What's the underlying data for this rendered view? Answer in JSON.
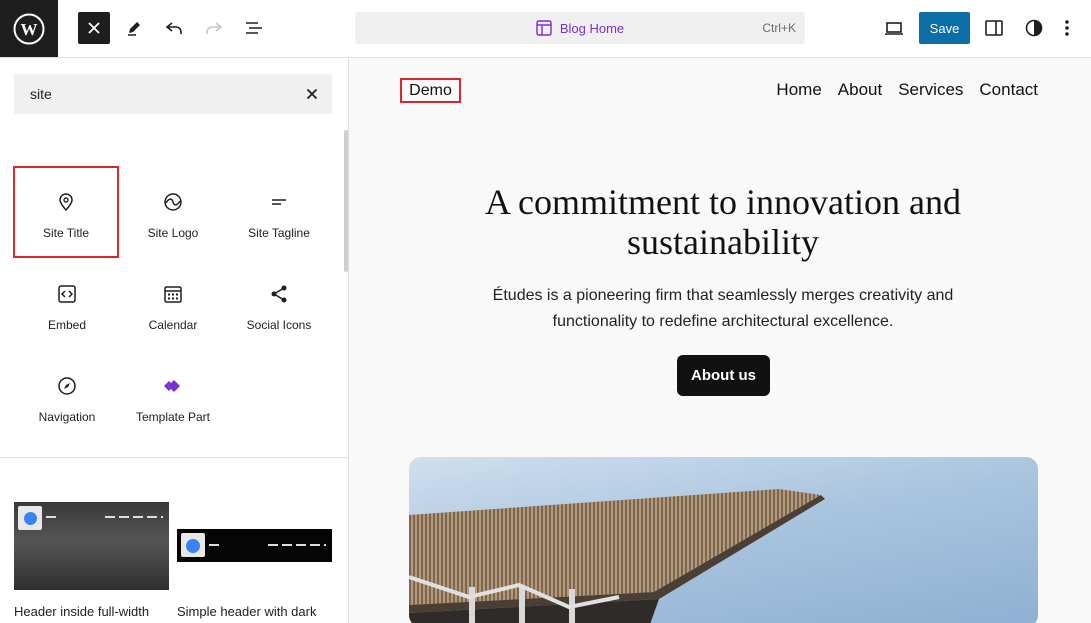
{
  "toolbar": {
    "logo_icon": "wordpress-icon",
    "close_icon": "close-icon",
    "pen_icon": "pencil-icon",
    "undo_icon": "undo-icon",
    "redo_icon": "redo-icon",
    "outline_icon": "list-view-icon",
    "template_label": "Blog Home",
    "template_icon": "layout-icon",
    "shortcut": "Ctrl+K",
    "view_icon": "desktop-icon",
    "save_label": "Save",
    "settings_icon": "sidebar-icon",
    "styles_icon": "contrast-icon",
    "more_icon": "more-vertical-icon",
    "accent_color": "#0b6ea6",
    "template_color": "#7b2fd0"
  },
  "sidebar": {
    "search": {
      "value": "site",
      "placeholder": ""
    },
    "blocks": [
      {
        "label": "Site Title",
        "icon": "map-pin-icon",
        "highlighted": true
      },
      {
        "label": "Site Logo",
        "icon": "site-logo-icon"
      },
      {
        "label": "Site Tagline",
        "icon": "tagline-icon"
      },
      {
        "label": "Embed",
        "icon": "embed-icon"
      },
      {
        "label": "Calendar",
        "icon": "calendar-icon"
      },
      {
        "label": "Social Icons",
        "icon": "share-icon"
      },
      {
        "label": "Navigation",
        "icon": "compass-icon"
      },
      {
        "label": "Template Part",
        "icon": "template-part-icon"
      }
    ],
    "patterns": [
      {
        "label": "Header inside full-width"
      },
      {
        "label": "Simple header with dark"
      }
    ]
  },
  "canvas": {
    "site_title": "Demo",
    "nav": [
      "Home",
      "About",
      "Services",
      "Contact"
    ],
    "hero_title": "A commitment to innovation and sustainability",
    "hero_text": "Études is a pioneering firm that seamlessly merges creativity and functionality to redefine architectural excellence.",
    "cta_label": "About us"
  }
}
